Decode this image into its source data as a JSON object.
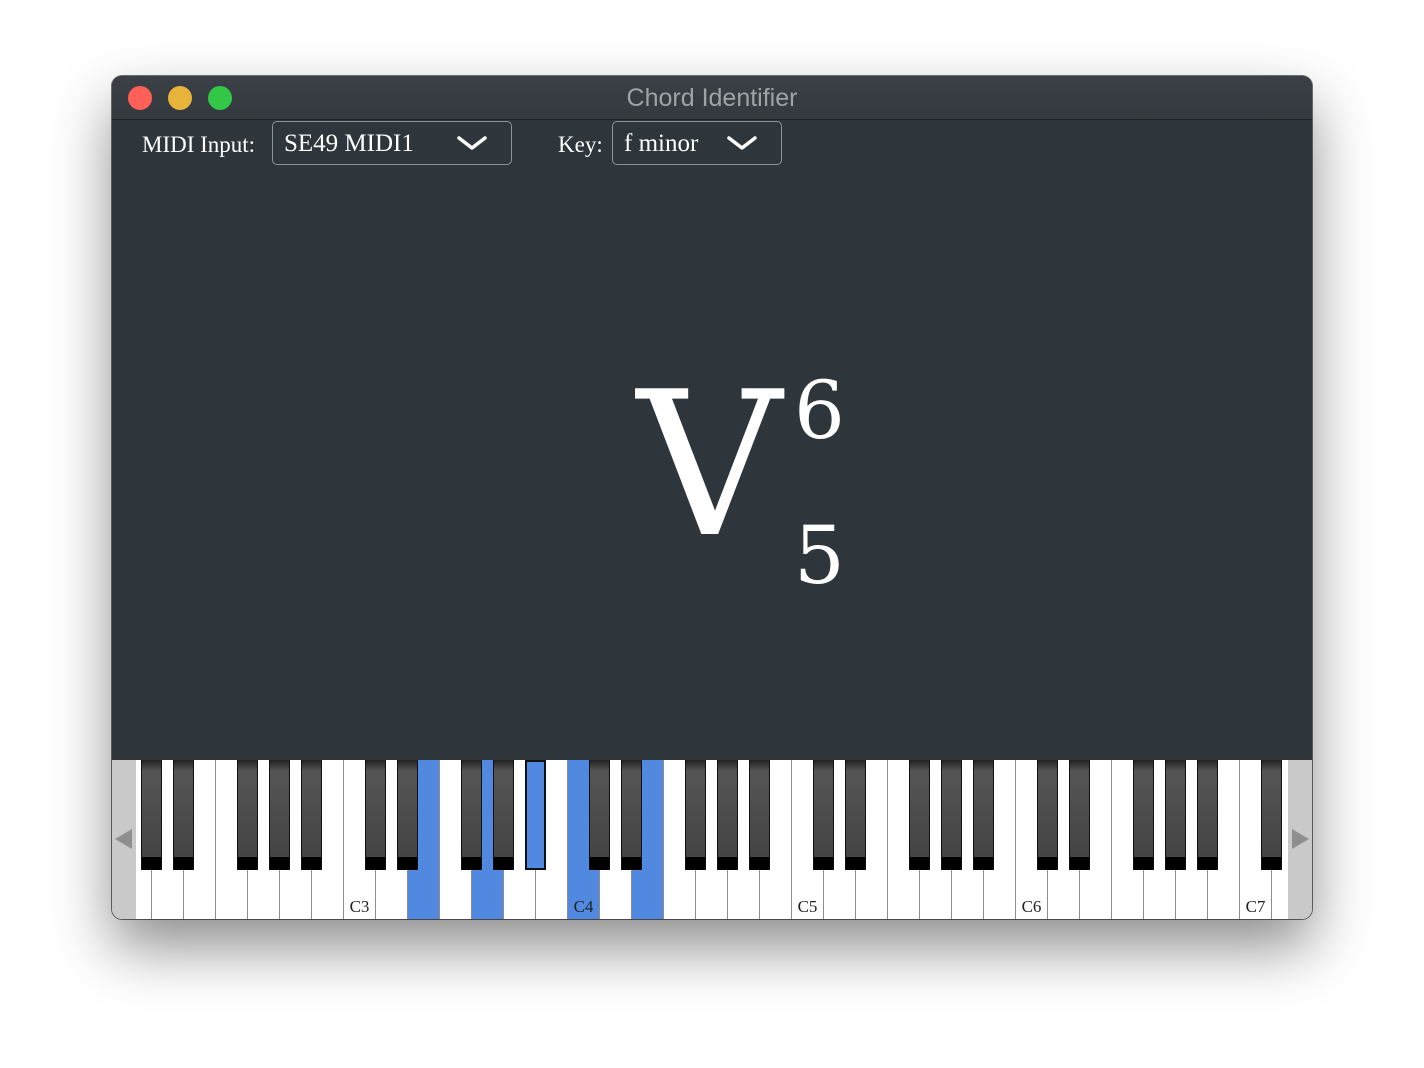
{
  "window": {
    "title": "Chord Identifier"
  },
  "toolbar": {
    "midi_label": "MIDI Input:",
    "midi_value": "SE49 MIDI1",
    "key_label": "Key:",
    "key_value": "f minor"
  },
  "chord": {
    "numeral": "V",
    "figure_top": "6",
    "figure_bottom": "5"
  },
  "keyboard": {
    "octave_labels": [
      "C3",
      "C4",
      "C5",
      "C6",
      "C7"
    ],
    "highlighted_notes": [
      "E3",
      "G3",
      "Bb3",
      "C4",
      "E4"
    ],
    "highlight_color": "#5289e0",
    "scroll_left_icon": "triangle-left-icon",
    "scroll_right_icon": "triangle-right-icon"
  }
}
